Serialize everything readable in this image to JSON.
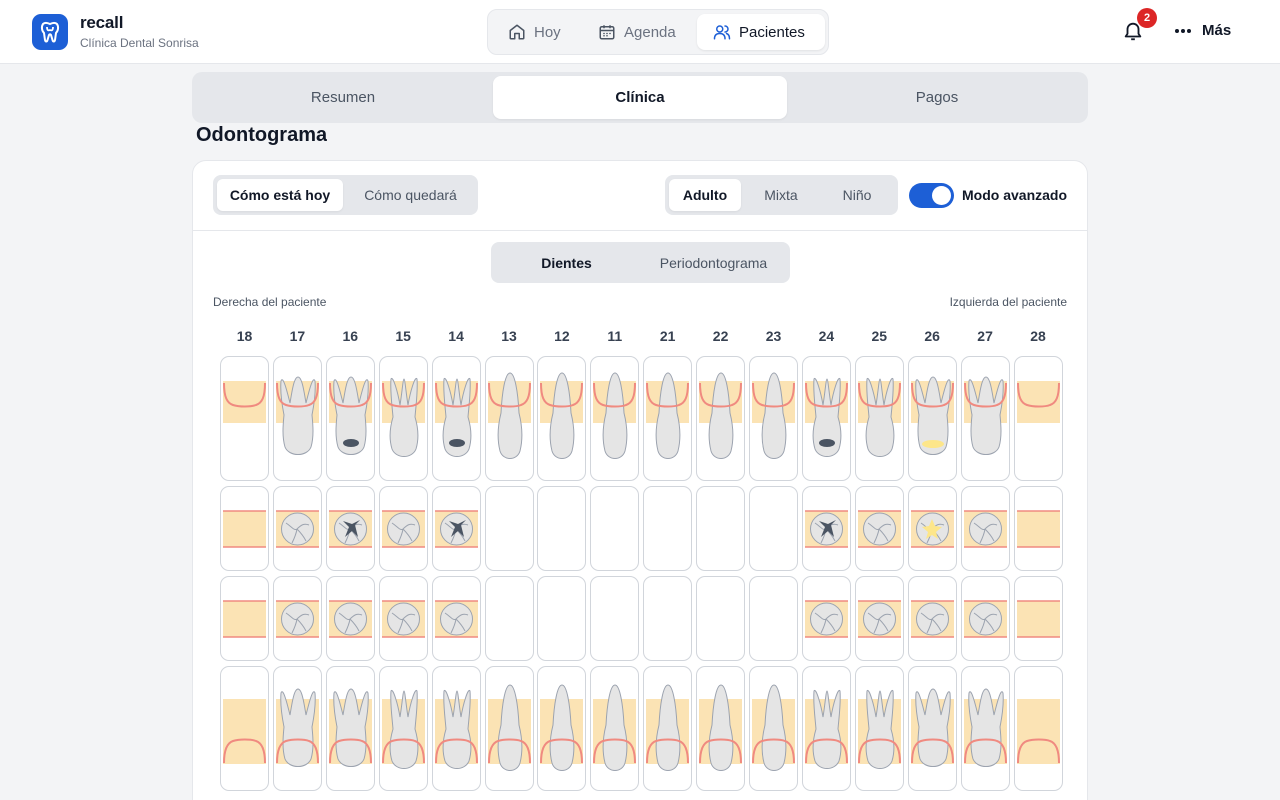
{
  "app": {
    "name": "recall",
    "clinic": "Clínica Dental Sonrisa"
  },
  "nav": [
    {
      "label": "Hoy",
      "icon": "home-icon"
    },
    {
      "label": "Agenda",
      "icon": "calendar-icon"
    },
    {
      "label": "Pacientes",
      "icon": "users-icon",
      "active": true
    }
  ],
  "notifications": {
    "count": "2"
  },
  "more_label": "Más",
  "sections": [
    {
      "label": "Resumen"
    },
    {
      "label": "Clínica",
      "active": true
    },
    {
      "label": "Pagos"
    }
  ],
  "odontogram": {
    "title": "Odontograma",
    "view_modes": [
      {
        "label": "Cómo está hoy",
        "active": true
      },
      {
        "label": "Cómo quedará"
      }
    ],
    "dentition": [
      {
        "label": "Adulto",
        "active": true
      },
      {
        "label": "Mixta"
      },
      {
        "label": "Niño"
      }
    ],
    "advanced_mode": {
      "label": "Modo avanzado",
      "on": true
    },
    "sub_tabs": [
      {
        "label": "Dientes",
        "active": true
      },
      {
        "label": "Periodontograma"
      }
    ],
    "patient_right": "Derecha del paciente",
    "patient_left": "Izquierda del paciente",
    "teeth": [
      "18",
      "17",
      "16",
      "15",
      "14",
      "13",
      "12",
      "11",
      "21",
      "22",
      "23",
      "24",
      "25",
      "26",
      "27",
      "28"
    ],
    "colors": {
      "gum": "#f08a80",
      "bone": "#fbe3b4",
      "tooth": "#e5e5e5",
      "outline": "#9ca3af",
      "restoration": "#4b5563",
      "highlight": "#fde68a",
      "accent": "#1d5fd6",
      "badge": "#dc2626"
    }
  }
}
